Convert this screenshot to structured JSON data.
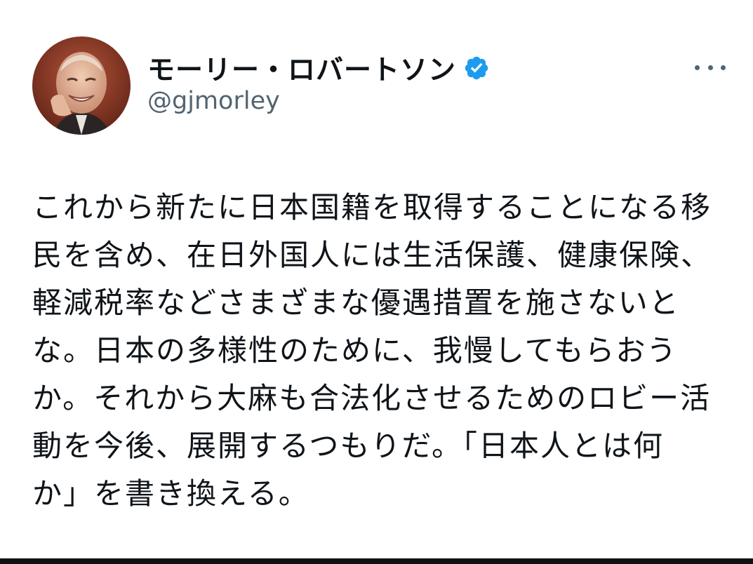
{
  "author": {
    "display_name": "モーリー・ロバートソン",
    "handle": "@gjmorley",
    "verified": true
  },
  "icons": {
    "verified": "verified-badge-icon",
    "more": "more-options-icon"
  },
  "colors": {
    "verified_badge": "#1d9bf0",
    "handle": "#536471",
    "text": "#0f1419"
  },
  "tweet": {
    "lines": [
      "これから新たに日本国籍を取得することになる移",
      "民を含め、在日外国人には生活保護、健康保険、",
      "軽減税率などさまざまな優遇措置を施さないと",
      "な。日本の多様性のために、我慢してもらおう",
      "か。それから大麻も合法化させるためのロビー活",
      "動を今後、展開するつもりだ。「日本人とは何",
      "か」を書き換える。"
    ]
  }
}
